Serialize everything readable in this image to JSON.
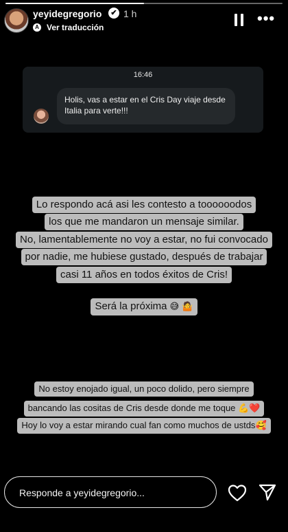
{
  "story": {
    "progress": 0.5
  },
  "header": {
    "username": "yeyidegregorio",
    "verified_glyph": "✔",
    "time_ago": "1 h",
    "translate_label": "Ver traducción",
    "icons": {
      "avatar": "profile-photo",
      "verified": "verified-badge-icon",
      "translate": "translate-icon",
      "pause": "pause-icon",
      "more": "more-icon"
    }
  },
  "dm": {
    "time": "16:46",
    "message": "Holis, vas a estar en el Cris Day viaje desde Italia para verte!!!"
  },
  "caption1": {
    "lines": [
      "Lo respondo acá  asi les contesto a toooooodos",
      "los que me mandaron un mensaje similar.",
      "No, lamentablemente no voy a estar, no fui convocado",
      "por nadie, me hubiese gustado, después de trabajar",
      "casi 11 años en todos éxitos de Cris!"
    ],
    "last_line": "Será la próxima",
    "last_emojis": "😅 🤷",
    "caption2_lines": [
      "No estoy enojado igual, un poco dolido, pero siempre",
      "bancando las cositas de Cris desde donde me toque"
    ]
  },
  "caption2": {
    "line2_emojis": "💪❤️",
    "line3": "Hoy lo voy a estar mirando cual fan como muchos de ustds",
    "line3_emoji": "🥰"
  },
  "footer": {
    "reply_placeholder": "Responde a yeyidegregorio...",
    "icons": {
      "like": "heart-icon",
      "share": "send-icon"
    }
  }
}
